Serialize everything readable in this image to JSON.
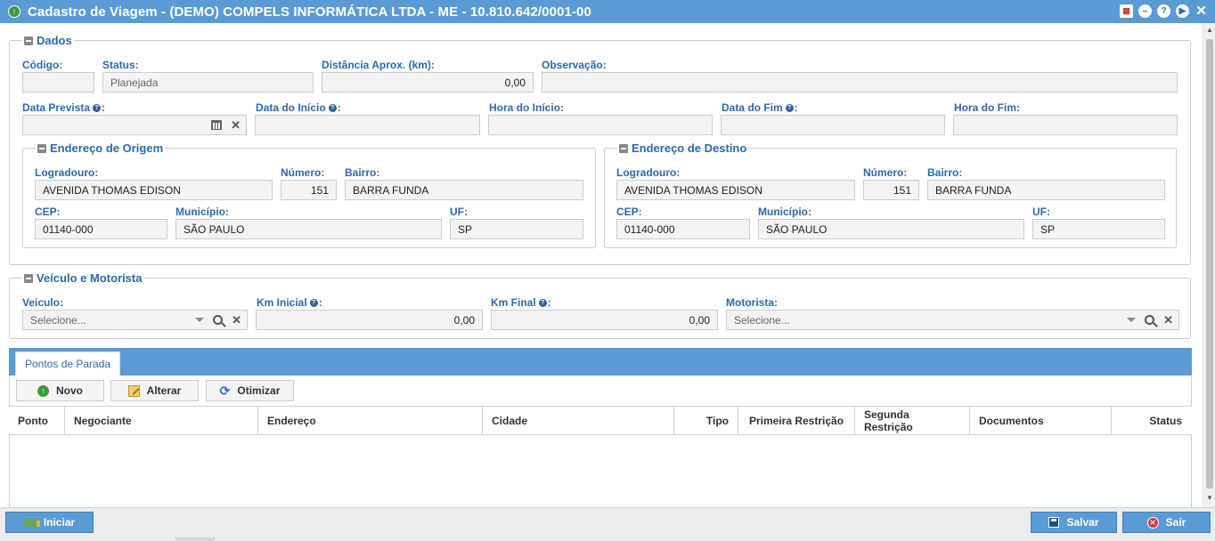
{
  "window": {
    "title": "Cadastro de Viagem - (DEMO) COMPELS INFORMÁTICA LTDA - ME - 10.810.642/0001-00"
  },
  "dados": {
    "legend": "Dados",
    "codigo": {
      "label": "Código:",
      "value": ""
    },
    "status": {
      "label": "Status:",
      "value": "Planejada"
    },
    "distancia": {
      "label": "Distância Aprox. (km):",
      "value": "0,00"
    },
    "observacao": {
      "label": "Observação:",
      "value": ""
    },
    "data_prevista": {
      "label": "Data Prevista",
      "value": ""
    },
    "data_inicio": {
      "label": "Data do Início",
      "value": ""
    },
    "hora_inicio": {
      "label": "Hora do Início:",
      "value": ""
    },
    "data_fim": {
      "label": "Data do Fim",
      "value": ""
    },
    "hora_fim": {
      "label": "Hora do Fim:",
      "value": ""
    },
    "help_mark": "?",
    "colon": ":"
  },
  "origem": {
    "legend": "Endereço de Origem",
    "logradouro": {
      "label": "Logradouro:",
      "value": "AVENIDA THOMAS EDISON"
    },
    "numero": {
      "label": "Número:",
      "value": "151"
    },
    "bairro": {
      "label": "Bairro:",
      "value": "BARRA FUNDA"
    },
    "cep": {
      "label": "CEP:",
      "value": "01140-000"
    },
    "municipio": {
      "label": "Município:",
      "value": "SÃO PAULO"
    },
    "uf": {
      "label": "UF:",
      "value": "SP"
    }
  },
  "destino": {
    "legend": "Endereço de Destino",
    "logradouro": {
      "label": "Logradouro:",
      "value": "AVENIDA THOMAS EDISON"
    },
    "numero": {
      "label": "Número:",
      "value": "151"
    },
    "bairro": {
      "label": "Bairro:",
      "value": "BARRA FUNDA"
    },
    "cep": {
      "label": "CEP:",
      "value": "01140-000"
    },
    "municipio": {
      "label": "Município:",
      "value": "SÃO PAULO"
    },
    "uf": {
      "label": "UF:",
      "value": "SP"
    }
  },
  "veiculo_motorista": {
    "legend": "Veículo e Motorista",
    "veiculo": {
      "label": "Veiculo:",
      "value": "Selecione..."
    },
    "km_inicial": {
      "label": "Km Inicial",
      "value": "0,00"
    },
    "km_final": {
      "label": "Km Final",
      "value": "0,00"
    },
    "motorista": {
      "label": "Motorista:",
      "value": "Selecione..."
    }
  },
  "tabs": [
    {
      "label": "Pontos de Parada",
      "active": true
    }
  ],
  "toolbar": {
    "novo": "Novo",
    "alterar": "Alterar",
    "otimizar": "Otimizar"
  },
  "grid": {
    "columns": [
      "Ponto",
      "Negociante",
      "Endereço",
      "Cidade",
      "Tipo",
      "Primeira Restrição",
      "Segunda Restrição",
      "Documentos",
      "Status"
    ],
    "rows": []
  },
  "footer": {
    "iniciar": "Iniciar",
    "salvar": "Salvar",
    "sair": "Sair"
  },
  "icons": {
    "app": "app-icon",
    "calendar": "calendar-icon",
    "search": "search-icon",
    "clear": "close-icon",
    "dropdown": "chevron-down-icon"
  },
  "colors": {
    "titlebar": "#5b9bd5",
    "label": "#2c6aab",
    "input_bg": "#f3f3f3",
    "button_bg": "#5b9bd5"
  }
}
